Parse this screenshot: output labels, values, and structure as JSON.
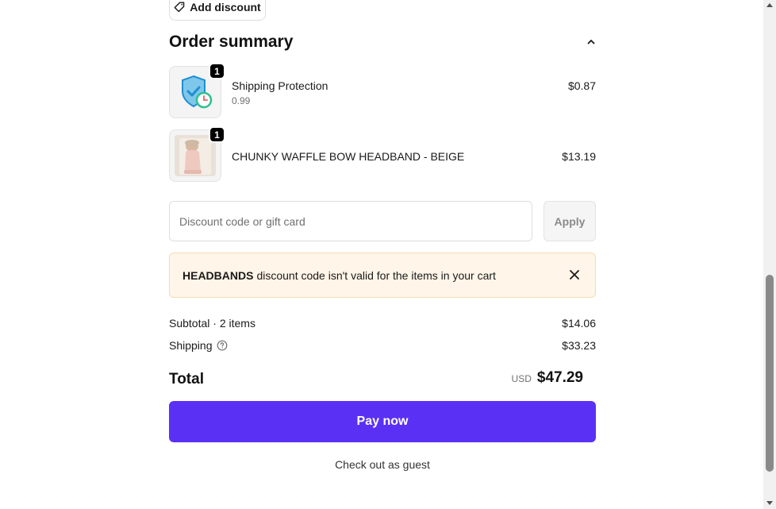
{
  "discount_chip": {
    "label": "Add discount",
    "icon": "tag-icon"
  },
  "order_summary": {
    "title": "Order summary",
    "toggle_icon": "chevron-up-icon",
    "items": [
      {
        "name": "Shipping Protection",
        "variant": "0.99",
        "quantity": "1",
        "price": "$0.87",
        "image": "shield-clock-icon"
      },
      {
        "name": "CHUNKY WAFFLE BOW HEADBAND - BEIGE",
        "quantity": "1",
        "price": "$13.19",
        "image": "baby-photo"
      }
    ]
  },
  "discount_form": {
    "placeholder": "Discount code or gift card",
    "value": "",
    "apply_label": "Apply"
  },
  "notice": {
    "code": "HEADBANDS",
    "message": "discount code isn't valid for the items in your cart",
    "close_icon": "close-icon"
  },
  "totals": {
    "subtotal_label": "Subtotal · 2 items",
    "subtotal_value": "$14.06",
    "shipping_label": "Shipping",
    "shipping_value": "$33.23",
    "total_label": "Total",
    "currency": "USD",
    "total_value": "$47.29"
  },
  "actions": {
    "pay_label": "Pay now",
    "guest_label": "Check out as guest"
  },
  "colors": {
    "pay_button": "#5a31f4",
    "notice_bg": "#fff5e8",
    "notice_border": "#f3dcb7",
    "badge": "#000000"
  }
}
